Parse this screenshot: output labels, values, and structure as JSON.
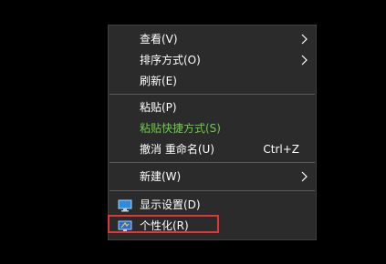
{
  "menu": {
    "items": [
      {
        "label": "查看(V)",
        "submenu": true
      },
      {
        "label": "排序方式(O)",
        "submenu": true
      },
      {
        "label": "刷新(E)"
      },
      {
        "label": "粘贴(P)"
      },
      {
        "label": "粘贴快捷方式(S)",
        "disabled": true
      },
      {
        "label": "撤消 重命名(U)",
        "shortcut": "Ctrl+Z"
      },
      {
        "label": "新建(W)",
        "submenu": true
      },
      {
        "label": "显示设置(D)",
        "icon": "display-icon"
      },
      {
        "label": "个性化(R)",
        "icon": "personalize-icon",
        "highlighted": true
      }
    ]
  },
  "colors": {
    "background": "#000000",
    "menu_bg": "#2b2b2b",
    "text": "#ffffff",
    "disabled_text": "#6ccb4a",
    "highlight_border": "#e03636"
  }
}
